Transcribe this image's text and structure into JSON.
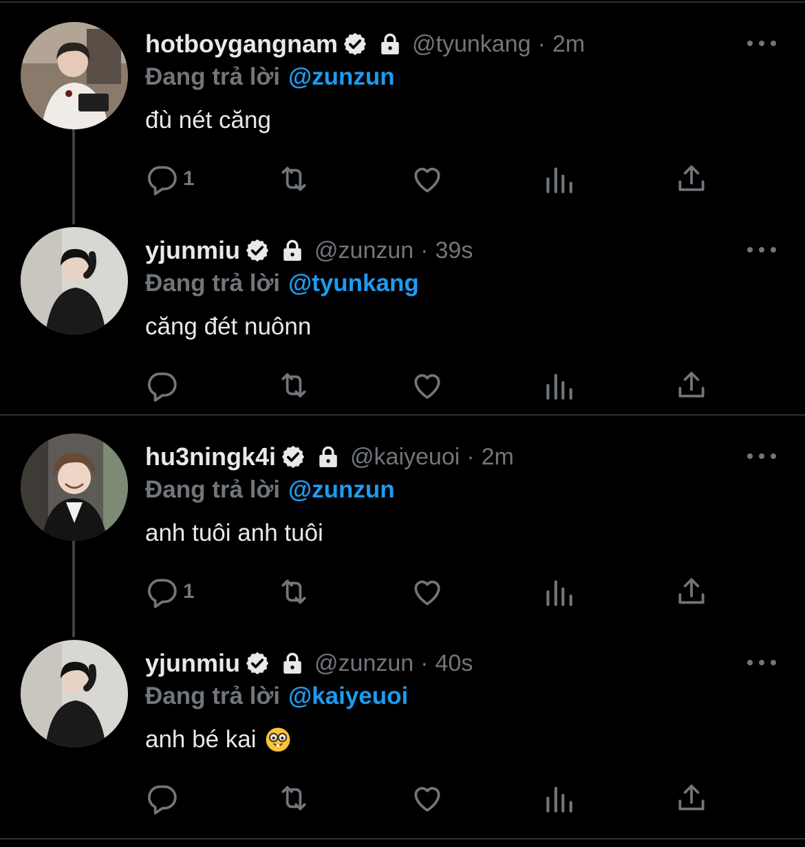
{
  "reply_prefix": "Đang trả lời",
  "colors": {
    "background": "#000000",
    "text_primary": "#e7e9ea",
    "text_secondary": "#71767b",
    "accent": "#1d9bf0",
    "divider": "#2f3336"
  },
  "tweets": [
    {
      "display_name": "hotboygangnam",
      "handle": "@tyunkang",
      "separator": "·",
      "time": "2m",
      "reply_to": "@zunzun",
      "text": "đù nét căng",
      "reply_count": "1",
      "avatar_icon": "avatar-photo"
    },
    {
      "display_name": "yjunmiu",
      "handle": "@zunzun",
      "separator": "·",
      "time": "39s",
      "reply_to": "@tyunkang",
      "text": "căng đét nuônn",
      "reply_count": "",
      "avatar_icon": "avatar-photo"
    },
    {
      "display_name": "hu3ningk4i",
      "handle": "@kaiyeuoi",
      "separator": "·",
      "time": "2m",
      "reply_to": "@zunzun",
      "text": "anh tuôi anh tuôi",
      "reply_count": "1",
      "avatar_icon": "avatar-photo"
    },
    {
      "display_name": "yjunmiu",
      "handle": "@zunzun",
      "separator": "·",
      "time": "40s",
      "reply_to": "@kaiyeuoi",
      "text": "anh bé kai",
      "emoji": "nerd-face-emoji",
      "reply_count": "",
      "avatar_icon": "avatar-photo"
    }
  ]
}
